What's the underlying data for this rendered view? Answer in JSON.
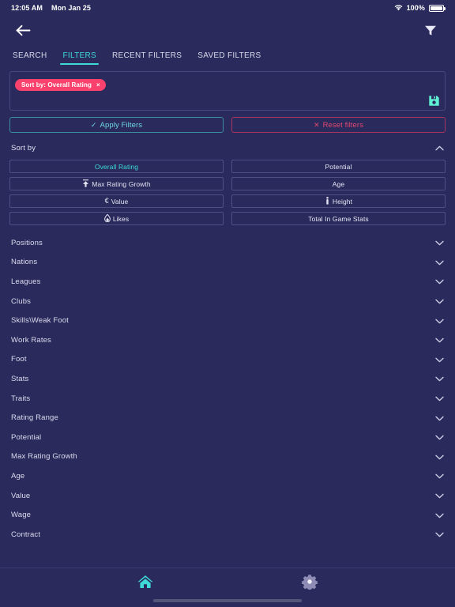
{
  "status_bar": {
    "time": "12:05 AM",
    "date": "Mon Jan 25",
    "battery_percent": "100%",
    "wifi_icon": "wifi-icon",
    "battery_icon": "battery-icon"
  },
  "app_bar": {
    "back_icon": "back-arrow-icon",
    "filter_icon": "funnel-icon"
  },
  "tabs": [
    {
      "label": "SEARCH",
      "active": false
    },
    {
      "label": "FILTERS",
      "active": true
    },
    {
      "label": "RECENT FILTERS",
      "active": false
    },
    {
      "label": "SAVED FILTERS",
      "active": false
    }
  ],
  "chips_panel": {
    "chips": [
      {
        "label": "Sort by: Overall Rating",
        "remove": "×"
      }
    ],
    "save_icon": "save-floppy-icon"
  },
  "actions": {
    "apply_label": "Apply Filters",
    "apply_icon": "✓",
    "reset_label": "Reset filters",
    "reset_icon": "✕"
  },
  "sort_section": {
    "title": "Sort by",
    "expanded": true,
    "chevron": "chevron-up-icon",
    "options": [
      {
        "label": "Overall Rating",
        "selected": true,
        "icon": null
      },
      {
        "label": "Potential",
        "selected": false,
        "icon": null
      },
      {
        "label": "Max Rating Growth",
        "selected": false,
        "icon": "arrow-up-bar-icon"
      },
      {
        "label": "Age",
        "selected": false,
        "icon": null
      },
      {
        "label": "Value",
        "selected": false,
        "icon": "euro-icon",
        "glyph": "€"
      },
      {
        "label": "Height",
        "selected": false,
        "icon": "person-height-icon"
      },
      {
        "label": "Likes",
        "selected": false,
        "icon": "flame-icon"
      },
      {
        "label": "Total In Game Stats",
        "selected": false,
        "icon": null
      }
    ]
  },
  "filter_sections": [
    {
      "label": "Positions",
      "chevron": "chevron-down-icon"
    },
    {
      "label": "Nations",
      "chevron": "chevron-down-icon"
    },
    {
      "label": "Leagues",
      "chevron": "chevron-down-icon"
    },
    {
      "label": "Clubs",
      "chevron": "chevron-down-icon"
    },
    {
      "label": "Skills\\Weak Foot",
      "chevron": "chevron-down-icon"
    },
    {
      "label": "Work Rates",
      "chevron": "chevron-down-icon"
    },
    {
      "label": "Foot",
      "chevron": "chevron-down-icon"
    },
    {
      "label": "Stats",
      "chevron": "chevron-down-icon"
    },
    {
      "label": "Traits",
      "chevron": "chevron-down-icon"
    },
    {
      "label": "Rating Range",
      "chevron": "chevron-down-icon"
    },
    {
      "label": "Potential",
      "chevron": "chevron-down-icon"
    },
    {
      "label": "Max Rating Growth",
      "chevron": "chevron-down-icon"
    },
    {
      "label": "Age",
      "chevron": "chevron-down-icon"
    },
    {
      "label": "Value",
      "chevron": "chevron-down-icon"
    },
    {
      "label": "Wage",
      "chevron": "chevron-down-icon"
    },
    {
      "label": "Contract",
      "chevron": "chevron-down-icon"
    }
  ],
  "bottom_nav": [
    {
      "icon": "home-icon",
      "active": true
    },
    {
      "icon": "gear-icon",
      "active": false
    }
  ],
  "colors": {
    "background": "#2a2a5c",
    "accent_teal": "#3ddad7",
    "accent_pink": "#f8416c",
    "border": "#514e85",
    "text": "#e3e2f2",
    "nav_inactive": "#8e8cb4"
  }
}
